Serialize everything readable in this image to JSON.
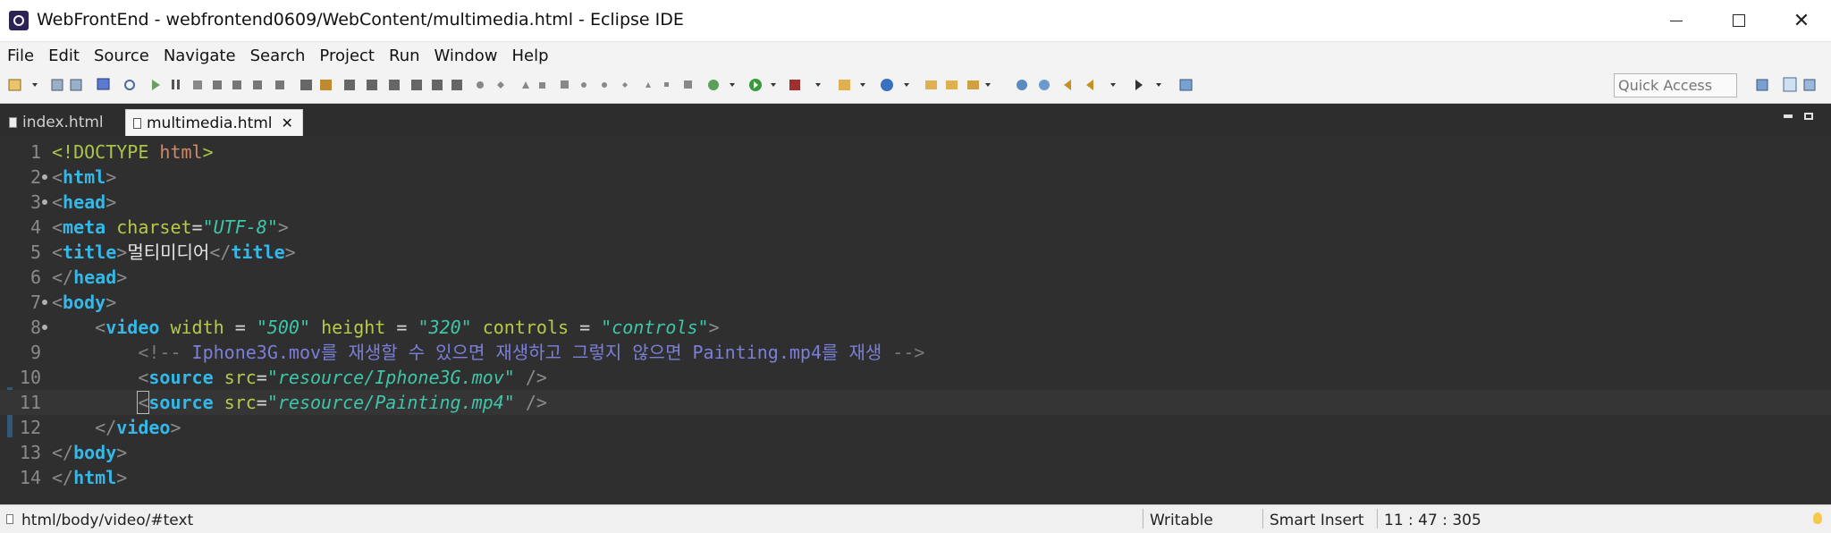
{
  "window": {
    "title": "WebFrontEnd - webfrontend0609/WebContent/multimedia.html - Eclipse IDE",
    "minimize_label": "",
    "maximize_label": "",
    "close_label": "✕"
  },
  "menu": [
    "File",
    "Edit",
    "Source",
    "Navigate",
    "Search",
    "Project",
    "Run",
    "Window",
    "Help"
  ],
  "toolbar": {
    "quick_access_placeholder": "Quick Access"
  },
  "tabs": [
    {
      "label": "index.html",
      "active": false
    },
    {
      "label": "multimedia.html",
      "active": true,
      "close": "✕"
    }
  ],
  "editor": {
    "lines": [
      {
        "num": "1",
        "fold": false
      },
      {
        "num": "2",
        "fold": true
      },
      {
        "num": "3",
        "fold": true
      },
      {
        "num": "4",
        "fold": false
      },
      {
        "num": "5",
        "fold": false
      },
      {
        "num": "6",
        "fold": false
      },
      {
        "num": "7",
        "fold": true
      },
      {
        "num": "8",
        "fold": true
      },
      {
        "num": "9",
        "fold": false
      },
      {
        "num": "10",
        "fold": false
      },
      {
        "num": "11",
        "fold": false
      },
      {
        "num": "12",
        "fold": false
      },
      {
        "num": "13",
        "fold": false
      },
      {
        "num": "14",
        "fold": false
      }
    ],
    "tokens": {
      "lt": "<",
      "gt": ">",
      "lt_slash": "</",
      "slash_gt": " />",
      "doctype": "!DOCTYPE",
      "doctype_name": " html",
      "html": "html",
      "head": "head",
      "meta": "meta",
      "charset": " charset",
      "eq": "=",
      "charset_val": "\"UTF-8\"",
      "title": "title",
      "title_text": "멀티미디어",
      "body": "body",
      "video": "video",
      "width": " width",
      "spaced_eq": " = ",
      "width_val": "\"500\"",
      "height": " height",
      "height_val": "\"320\"",
      "controls": " controls",
      "controls_val": "\"controls\"",
      "comment_open": "<!--",
      "comment_text": " Iphone3G.mov를 재생할 수 있으면 재생하고 그렇지 않으면 Painting.mp4를 재생 ",
      "comment_close": "-->",
      "source": "source",
      "src": " src",
      "src1_val": "\"resource/Iphone3G.mov\"",
      "src2_val": "\"resource/Painting.mp4\""
    }
  },
  "status": {
    "path": "html/body/video/#text",
    "writable": "Writable",
    "insert_mode": "Smart Insert",
    "position": "11 : 47 : 305"
  }
}
